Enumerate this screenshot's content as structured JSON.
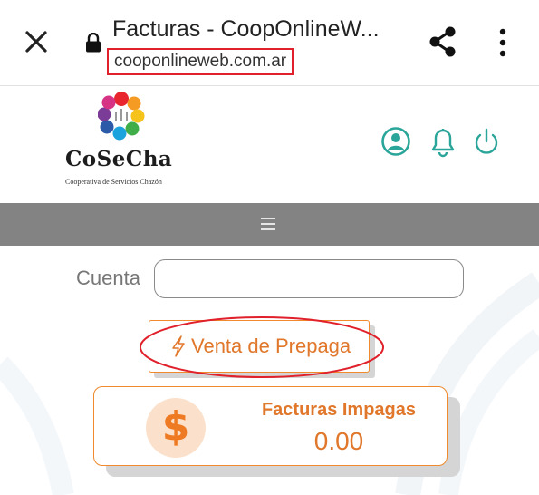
{
  "browser": {
    "page_title": "Facturas - CoopOnlineW...",
    "url": "cooponlineweb.com.ar",
    "icons": [
      "close-icon",
      "lock-icon",
      "share-icon",
      "more-vert-icon"
    ]
  },
  "header": {
    "logo_name": "CoSeCha",
    "logo_subtitle": "Cooperativa de Servicios Chazón",
    "icons": [
      "user-icon",
      "bell-icon",
      "power-icon"
    ]
  },
  "nav": {
    "menu_icon": "hamburger-icon"
  },
  "form": {
    "cuenta_label": "Cuenta",
    "cuenta_value": ""
  },
  "prepaga": {
    "label": "Venta de Prepaga",
    "icon": "bolt-icon"
  },
  "facturas": {
    "title": "Facturas Impagas",
    "amount": "0.00",
    "currency_symbol": "$"
  },
  "colors": {
    "accent_orange": "#e0772a",
    "nav_gray": "#838383",
    "annotation_red": "#e0202a"
  }
}
